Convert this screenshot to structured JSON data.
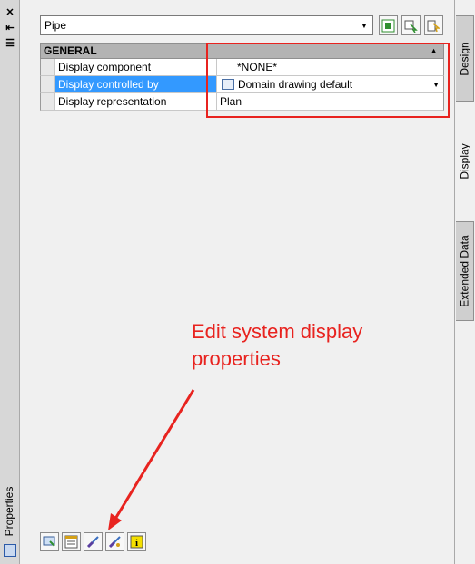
{
  "window": {
    "title": "Properties",
    "close_glyph": "✕",
    "autohide_glyph": "⇤",
    "menu_glyph": "☰"
  },
  "tabs": [
    {
      "label": "Design",
      "active": false
    },
    {
      "label": "Display",
      "active": true
    },
    {
      "label": "Extended Data",
      "active": false
    }
  ],
  "selector": {
    "value": "Pipe"
  },
  "toolbar": {
    "icons": [
      "quick-select-icon",
      "select-objects-icon",
      "toggle-pickadd-icon"
    ]
  },
  "grid": {
    "section_title": "GENERAL",
    "rows": [
      {
        "name": "Display component",
        "value": "*NONE*",
        "selected": false
      },
      {
        "name": "Display controlled by",
        "value": "Domain drawing default",
        "selected": true
      },
      {
        "name": "Display representation",
        "value": "Plan",
        "selected": false
      }
    ]
  },
  "annotation": {
    "text_line1": "Edit system display",
    "text_line2": "properties",
    "color": "#e8231f"
  },
  "bottom_toolbar": {
    "icons": [
      "select-display-icon",
      "display-properties-icon",
      "edit-display-brush-icon",
      "edit-system-display-icon",
      "info-icon"
    ]
  },
  "colors": {
    "selection": "#3399ff",
    "annotation_red": "#e8231f",
    "header_gray": "#b3b3b3"
  }
}
